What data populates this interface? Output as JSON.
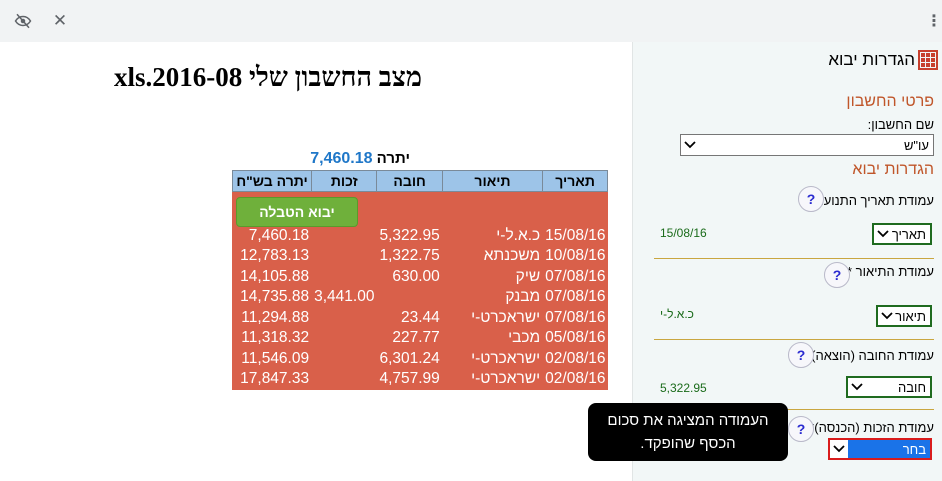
{
  "toolbar": {
    "icons": [
      "eye-off-icon",
      "close-icon",
      "more-vert-icon"
    ]
  },
  "main": {
    "title": "מצב החשבון שלי 2016-08.xls",
    "balance_label": "יתרה",
    "balance_value": "7,460.18",
    "import_button": "יבוא הטבלה",
    "columns": [
      "תאריך",
      "תיאור",
      "חובה",
      "זכות",
      "יתרה בש\"ח"
    ],
    "rows": [
      {
        "date": "15/08/16",
        "desc": "כ.א.ל-י",
        "debit": "5,322.95",
        "credit": "",
        "balance": "7,460.18"
      },
      {
        "date": "10/08/16",
        "desc": "משכנתא",
        "debit": "1,322.75",
        "credit": "",
        "balance": "12,783.13"
      },
      {
        "date": "07/08/16",
        "desc": "שיק",
        "debit": "630.00",
        "credit": "",
        "balance": "14,105.88"
      },
      {
        "date": "07/08/16",
        "desc": "מבנק",
        "debit": "",
        "credit": "3,441.00",
        "balance": "14,735.88"
      },
      {
        "date": "07/08/16",
        "desc": "ישראכרט-י",
        "debit": "23.44",
        "credit": "",
        "balance": "11,294.88"
      },
      {
        "date": "05/08/16",
        "desc": "מכבי",
        "debit": "227.77",
        "credit": "",
        "balance": "11,318.32"
      },
      {
        "date": "02/08/16",
        "desc": "ישראכרט-י",
        "debit": "6,301.24",
        "credit": "",
        "balance": "11,546.09"
      },
      {
        "date": "02/08/16",
        "desc": "ישראכרט-י",
        "debit": "4,757.99",
        "credit": "",
        "balance": "17,847.33"
      }
    ]
  },
  "panel": {
    "title": "הגדרות יבוא",
    "account_section": "פרטי החשבון",
    "account_name_label": "שם החשבון:",
    "account_name_value": "עו\"ש",
    "import_section": "הגדרות יבוא",
    "help_glyph": "?",
    "date_col_label": "עמודת תאריך התנועה*:",
    "date_col_value": "תאריך",
    "date_preview": "15/08/16",
    "desc_col_label": "עמודת התיאור *:",
    "desc_col_value": "תיאור",
    "desc_preview": "כ.א.ל-י",
    "debit_col_label": "עמודת החובה (הוצאה)*:",
    "debit_col_value": "חובה",
    "debit_preview": "5,322.95",
    "credit_col_label": "עמודת הזכות (הכנסה)*:",
    "credit_col_value": "בחר",
    "tooltip": "העמודה המציגה את סכום הכסף שהופקד."
  },
  "colors": {
    "table_bg": "#d9604a",
    "header_bg": "#9dc4e8",
    "button_green": "#6fb03b",
    "section_orange": "#c0562a"
  }
}
